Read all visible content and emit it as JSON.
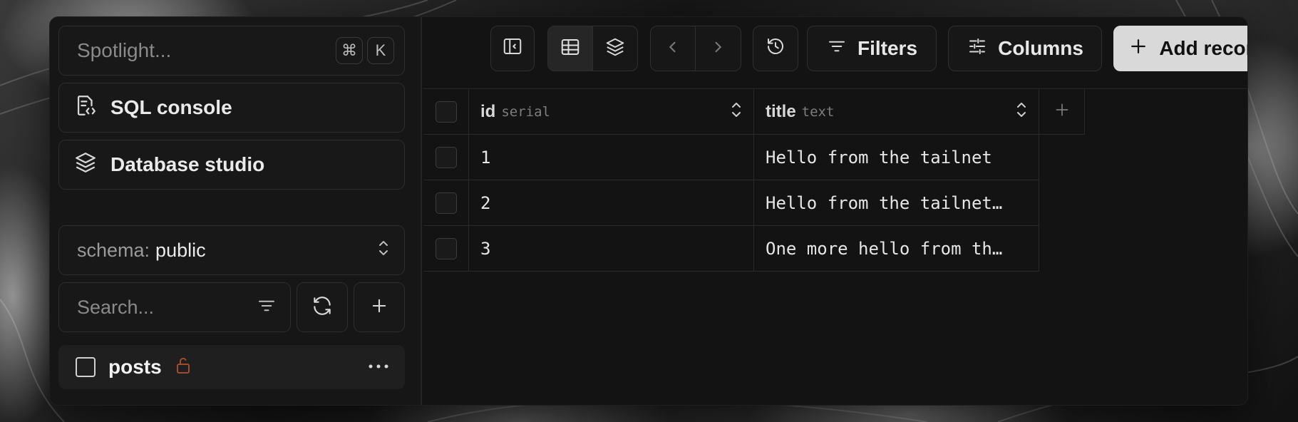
{
  "sidebar": {
    "spotlight": {
      "placeholder": "Spotlight...",
      "shortcut_mod": "⌘",
      "shortcut_key": "K"
    },
    "nav": [
      {
        "label": "SQL console",
        "icon": "sql-console-icon"
      },
      {
        "label": "Database studio",
        "icon": "layers-icon"
      }
    ],
    "schema": {
      "label": "schema:",
      "value": "public"
    },
    "search": {
      "placeholder": "Search..."
    },
    "tables": [
      {
        "name": "posts",
        "lock_icon": "unlock-icon",
        "lock_color": "#b2512e"
      }
    ]
  },
  "toolbar": {
    "filters_label": "Filters",
    "columns_label": "Columns",
    "add_record_label": "Add record"
  },
  "grid": {
    "columns": [
      {
        "name": "id",
        "type": "serial"
      },
      {
        "name": "title",
        "type": "text"
      }
    ],
    "rows": [
      {
        "id": "1",
        "title": "Hello from the tailnet"
      },
      {
        "id": "2",
        "title": "Hello from the tailnet…"
      },
      {
        "id": "3",
        "title": "One more hello from th…"
      }
    ]
  },
  "colors": {
    "accent_button": "#d9d9d9",
    "window_bg": "#131313",
    "lock_icon": "#b2512e"
  }
}
